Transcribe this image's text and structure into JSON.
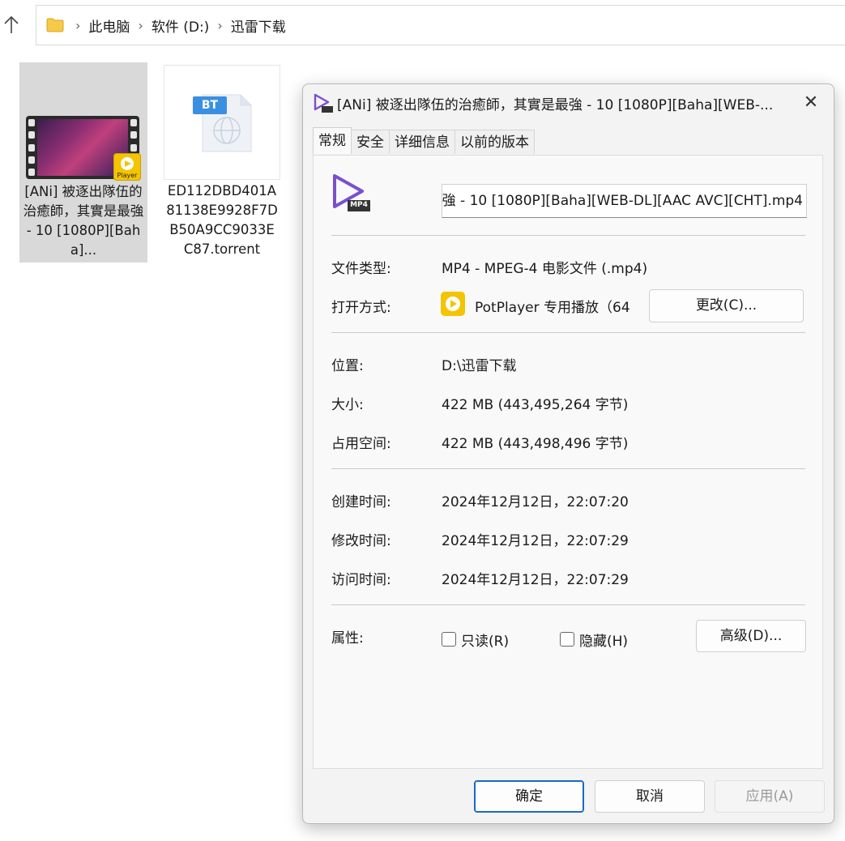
{
  "breadcrumb": {
    "items": [
      "此电脑",
      "软件 (D:)",
      "迅雷下载"
    ]
  },
  "files": [
    {
      "name": "[ANi] 被逐出隊伍的治癒師，其實是最強 - 10 [1080P][Baha]...",
      "badge": "Player",
      "selected": true
    },
    {
      "name": "ED112DBD401A81138E9928F7DB50A9CC9033EC87.torrent",
      "badge": "BT",
      "selected": false
    }
  ],
  "dialog": {
    "title": "[ANi] 被逐出隊伍的治癒師，其實是最強 - 10 [1080P][Baha][WEB-...",
    "close": "✕",
    "icon_badge": "MP4",
    "tabs": [
      "常规",
      "安全",
      "详细信息",
      "以前的版本"
    ],
    "active_tab": "常规",
    "filename_value": "強 - 10 [1080P][Baha][WEB-DL][AAC AVC][CHT].mp4",
    "file_type_label": "文件类型:",
    "file_type_value": "MP4 - MPEG-4 电影文件 (.mp4)",
    "open_with_label": "打开方式:",
    "open_with_value": "PotPlayer 专用播放（64",
    "change_button": "更改(C)...",
    "location_label": "位置:",
    "location_value": "D:\\迅雷下载",
    "size_label": "大小:",
    "size_value": "422 MB (443,495,264 字节)",
    "size_on_disk_label": "占用空间:",
    "size_on_disk_value": "422 MB (443,498,496 字节)",
    "created_label": "创建时间:",
    "created_value": "2024年12月12日，22:07:20",
    "modified_label": "修改时间:",
    "modified_value": "2024年12月12日，22:07:29",
    "accessed_label": "访问时间:",
    "accessed_value": "2024年12月12日，22:07:29",
    "attributes_label": "属性:",
    "readonly_label": "只读(R)",
    "readonly_checked": false,
    "hidden_label": "隐藏(H)",
    "hidden_checked": false,
    "advanced_button": "高级(D)...",
    "ok_button": "确定",
    "cancel_button": "取消",
    "apply_button": "应用(A)"
  },
  "colors": {
    "accent": "#1868c4",
    "mp4_icon": "#7a4fcf",
    "potplayer": "#f4c400",
    "bt_blue": "#3b8fe0"
  }
}
